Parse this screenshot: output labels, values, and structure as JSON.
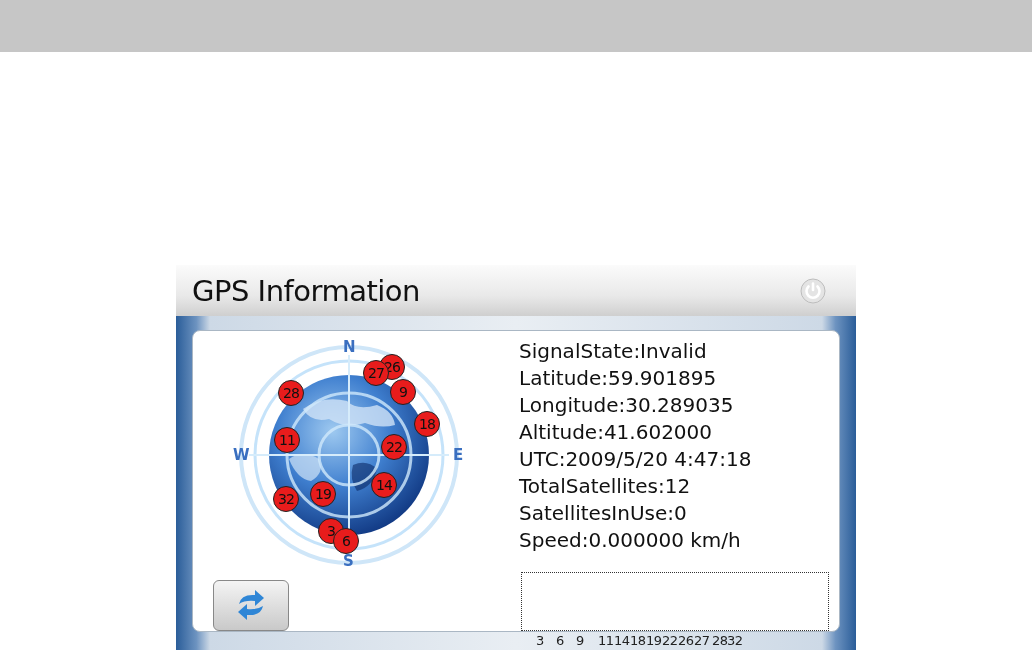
{
  "window": {
    "title": "GPS Information"
  },
  "sky_plot": {
    "north": "N",
    "south": "S",
    "west": "W",
    "east": "E",
    "satellites": [
      {
        "label": "28"
      },
      {
        "label": "26"
      },
      {
        "label": "27"
      },
      {
        "label": "9"
      },
      {
        "label": "18"
      },
      {
        "label": "11"
      },
      {
        "label": "22"
      },
      {
        "label": "14"
      },
      {
        "label": "32"
      },
      {
        "label": "19"
      },
      {
        "label": "3"
      },
      {
        "label": "6"
      }
    ]
  },
  "info": [
    "SignalState:Invalid",
    "Latitude:59.901895",
    "Longitude:30.289035",
    "Altitude:41.602000",
    "UTC:2009/5/20 4:47:18",
    "TotalSatellites:12",
    "SatellitesInUse:0",
    "Speed:0.000000 km/h"
  ],
  "signal_labels": [
    "3",
    "6",
    "9",
    "11",
    "14",
    "18",
    "19",
    "22",
    "26",
    "27",
    "28",
    "32"
  ]
}
